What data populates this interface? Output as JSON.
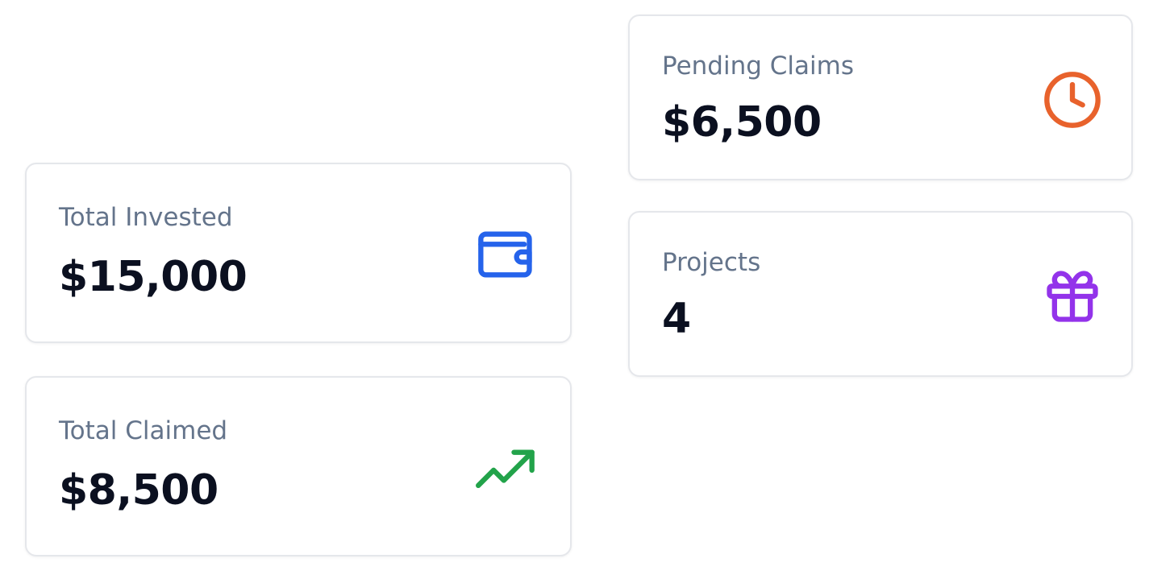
{
  "cards": {
    "pending_claims": {
      "label": "Pending Claims",
      "value": "$6,500",
      "icon": "clock-icon",
      "icon_color": "#e8622c"
    },
    "projects": {
      "label": "Projects",
      "value": "4",
      "icon": "gift-icon",
      "icon_color": "#9333ea"
    },
    "total_invested": {
      "label": "Total Invested",
      "value": "$15,000",
      "icon": "wallet-icon",
      "icon_color": "#2563eb"
    },
    "total_claimed": {
      "label": "Total Claimed",
      "value": "$8,500",
      "icon": "trending-up-icon",
      "icon_color": "#22a34a"
    }
  }
}
